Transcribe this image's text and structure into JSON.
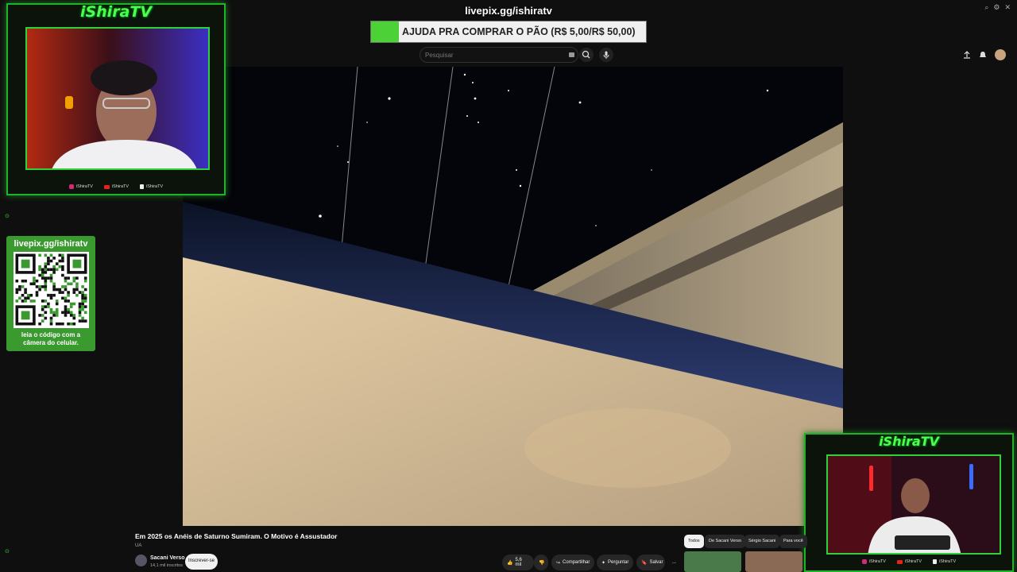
{
  "stream": {
    "brand": "iShiraTV",
    "social_instagram": "iShiraTV",
    "social_youtube": "iShiraTV",
    "social_tiktok": "iShiraTV"
  },
  "donation": {
    "url": "livepix.gg/ishiratv",
    "goal_text": "AJUDA PRA COMPRAR O PÃO (R$ 5,00/R$ 50,00)",
    "progress_fraction": 0.1,
    "fill_color": "#4cd137"
  },
  "qr": {
    "url": "livepix.gg/ishiratv",
    "caption_line1": "leia o código com a",
    "caption_line2": "câmera do celular."
  },
  "search": {
    "placeholder": "Pesquisar"
  },
  "video": {
    "title": "Em 2025 os Anéis de Saturno Sumiram. O Motivo é Assustador",
    "views_hint": "UA",
    "channel": "Sacani Verso",
    "subscribers": "14,1 mil inscritos",
    "subscribe_label": "Inscrever-se",
    "likes": "5,6 mil",
    "share_label": "Compartilhar",
    "ask_label": "Perguntar",
    "save_label": "Salvar",
    "more_label": "..."
  },
  "chips": [
    "Todos",
    "De Sacani Verso",
    "Sérgio Sacani",
    "Para você"
  ],
  "colors": {
    "accent_green": "#1db32a",
    "brand_green": "#4cff4c"
  },
  "icons": [
    "upload-icon",
    "bell-icon",
    "search-icon",
    "mic-icon",
    "like-icon",
    "dislike-icon",
    "share-icon",
    "sparkle-icon",
    "bookmark-icon"
  ]
}
